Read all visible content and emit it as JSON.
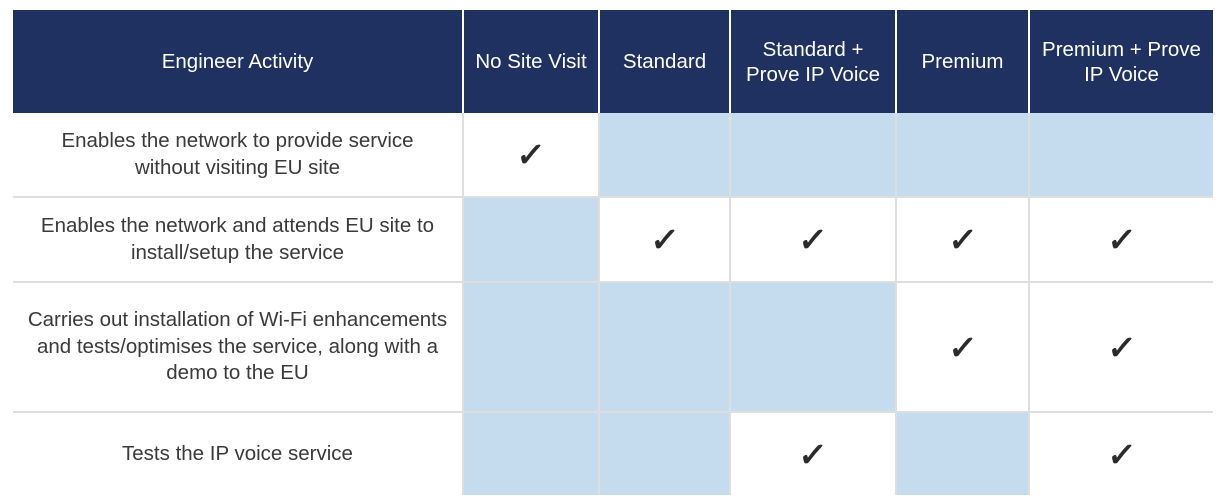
{
  "table": {
    "columns": [
      {
        "key": "activity",
        "label": "Engineer Activity"
      },
      {
        "key": "no_site_visit",
        "label": "No Site Visit"
      },
      {
        "key": "standard",
        "label": "Standard"
      },
      {
        "key": "standard_prove_ip_voice",
        "label": "Standard + Prove IP Voice"
      },
      {
        "key": "premium",
        "label": "Premium"
      },
      {
        "key": "premium_prove_ip_voice",
        "label": "Premium + Prove IP Voice"
      }
    ],
    "rows": [
      {
        "activity": "Enables the network to provide service without visiting EU site",
        "marks": [
          true,
          false,
          false,
          false,
          false
        ]
      },
      {
        "activity": "Enables the network and attends EU site to install/setup the service",
        "marks": [
          false,
          true,
          true,
          true,
          true
        ]
      },
      {
        "activity": "Carries out installation of Wi-Fi enhancements and tests/optimises the service, along with a demo to the EU",
        "marks": [
          false,
          false,
          false,
          true,
          true
        ]
      },
      {
        "activity": "Tests the IP voice service",
        "marks": [
          false,
          false,
          true,
          false,
          true
        ]
      }
    ],
    "check_glyph": "✓",
    "colors": {
      "header_background": "#1F3160",
      "header_text": "#FFFFFF",
      "cell_unavailable": "#C5DCEF",
      "cell_available": "#FFFFFF",
      "body_text": "#3A3A3A",
      "grid_line": "#DEDEDE",
      "check_color": "#2B2B2B"
    }
  }
}
